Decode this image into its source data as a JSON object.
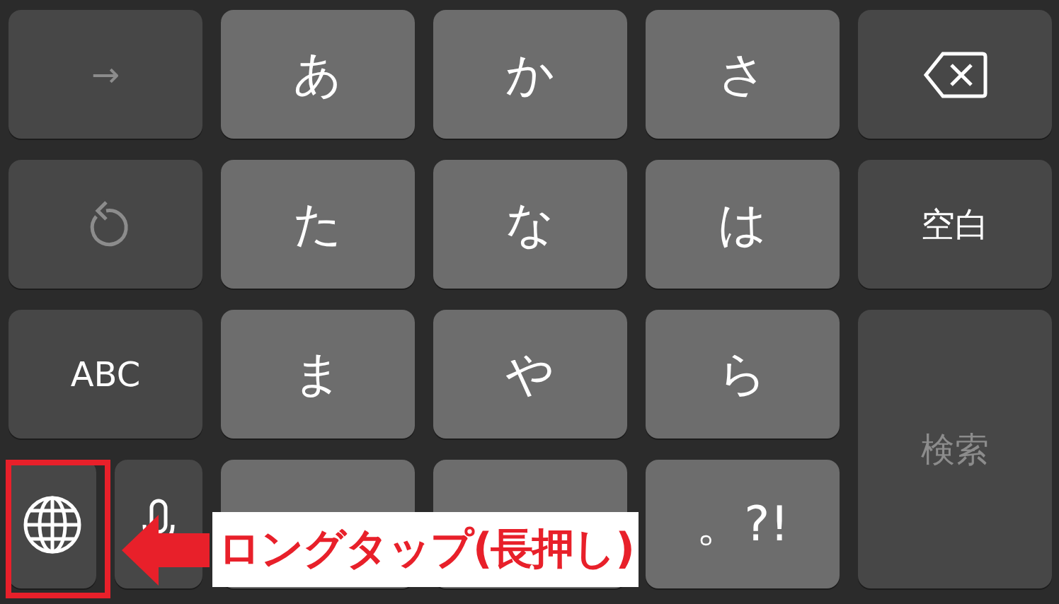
{
  "keyboard": {
    "rows": [
      [
        {
          "kind": "text",
          "label": "→",
          "dark": true,
          "disabled": true
        },
        {
          "kind": "text",
          "label": "あ",
          "dark": false,
          "disabled": false
        },
        {
          "kind": "text",
          "label": "か",
          "dark": false,
          "disabled": false
        },
        {
          "kind": "text",
          "label": "さ",
          "dark": false,
          "disabled": false
        },
        {
          "kind": "delete",
          "dark": true,
          "disabled": false
        }
      ],
      [
        {
          "kind": "undo",
          "dark": true,
          "disabled": true
        },
        {
          "kind": "text",
          "label": "た",
          "dark": false,
          "disabled": false
        },
        {
          "kind": "text",
          "label": "な",
          "dark": false,
          "disabled": false
        },
        {
          "kind": "text",
          "label": "は",
          "dark": false,
          "disabled": false
        },
        {
          "kind": "text",
          "label": "空白",
          "dark": true,
          "disabled": false
        }
      ],
      [
        {
          "kind": "text",
          "label": "ABC",
          "dark": true,
          "disabled": false
        },
        {
          "kind": "text",
          "label": "ま",
          "dark": false,
          "disabled": false
        },
        {
          "kind": "text",
          "label": "や",
          "dark": false,
          "disabled": false
        },
        {
          "kind": "text",
          "label": "ら",
          "dark": false,
          "disabled": false
        },
        {
          "kind": "tall",
          "label": "検索",
          "dark": true,
          "disabled": true
        }
      ],
      [
        {
          "kind": "split",
          "keys": [
            {
              "kind": "globe",
              "dark": true,
              "disabled": false
            },
            {
              "kind": "mic",
              "dark": true,
              "disabled": false
            }
          ]
        },
        {
          "kind": "blank",
          "dark": false
        },
        {
          "kind": "blank",
          "dark": false
        },
        {
          "kind": "text",
          "label": "。?!",
          "dark": false,
          "disabled": false
        }
      ]
    ]
  },
  "annotation": {
    "label": "ロングタップ(長押し)"
  }
}
